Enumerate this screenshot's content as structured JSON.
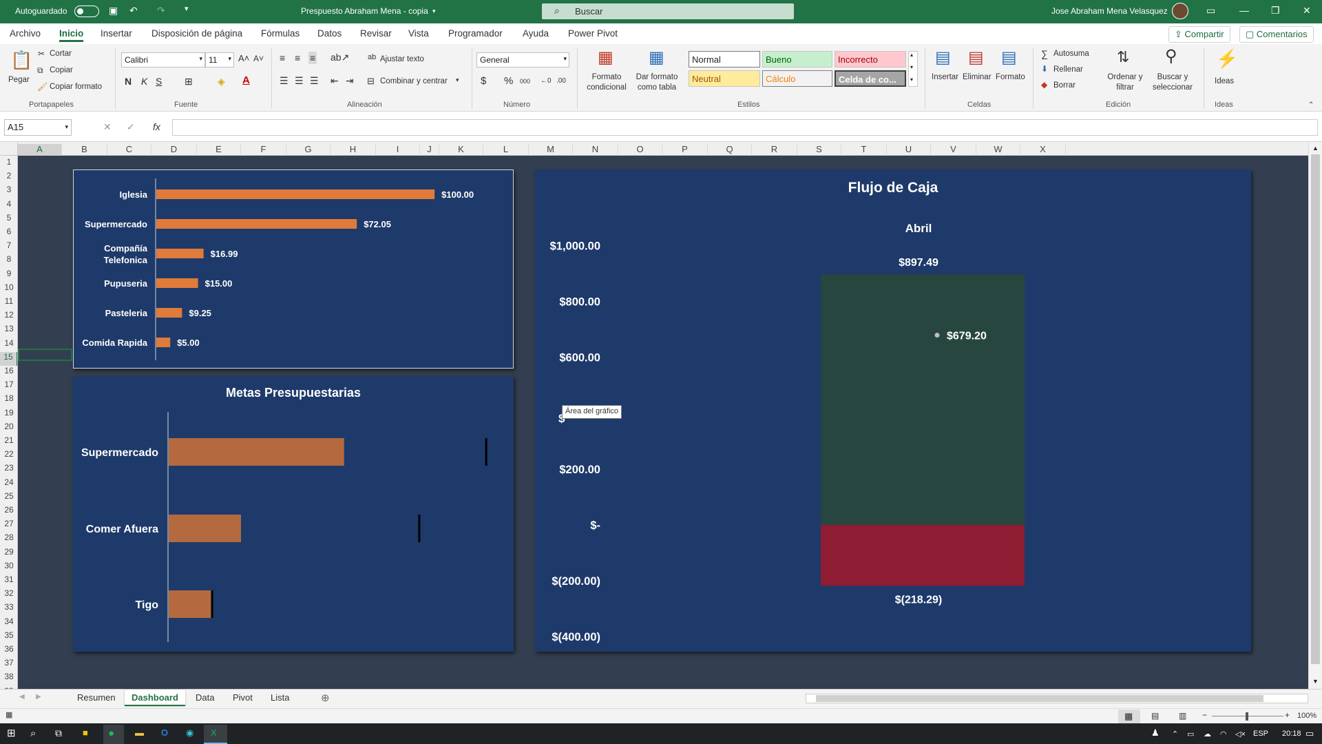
{
  "titlebar": {
    "autosave_label": "Autoguardado",
    "file_title": "Prespuesto Abraham Mena - copia",
    "search_placeholder": "Buscar",
    "user": "Jose Abraham Mena Velasquez"
  },
  "menu": {
    "items": [
      "Archivo",
      "Inicio",
      "Insertar",
      "Disposición de página",
      "Fórmulas",
      "Datos",
      "Revisar",
      "Vista",
      "Programador",
      "Ayuda",
      "Power Pivot"
    ],
    "share": "Compartir",
    "comments": "Comentarios"
  },
  "ribbon": {
    "clipboard": {
      "paste": "Pegar",
      "cut": "Cortar",
      "copy": "Copiar",
      "format_painter": "Copiar formato",
      "label": "Portapapeles"
    },
    "font": {
      "name": "Calibri",
      "size": "11",
      "bold": "N",
      "italic": "K",
      "underline": "S",
      "label": "Fuente"
    },
    "alignment": {
      "wrap": "Ajustar texto",
      "merge": "Combinar y centrar",
      "label": "Alineación"
    },
    "number": {
      "format": "General",
      "label": "Número"
    },
    "styles": {
      "conditional": [
        "Formato",
        "condicional"
      ],
      "as_table": [
        "Dar formato",
        "como tabla"
      ],
      "normal": "Normal",
      "bueno": "Bueno",
      "incorrecto": "Incorrecto",
      "neutral": "Neutral",
      "calculo": "Cálculo",
      "celda": "Celda de co...",
      "label": "Estilos"
    },
    "cells": {
      "insert": "Insertar",
      "delete": "Eliminar",
      "format": "Formato",
      "label": "Celdas"
    },
    "editing": {
      "autosum": "Autosuma",
      "fill": "Rellenar",
      "clear": "Borrar",
      "sort": [
        "Ordenar y",
        "filtrar"
      ],
      "find": [
        "Buscar y",
        "seleccionar"
      ],
      "label": "Edición"
    },
    "ideas": {
      "button": "Ideas",
      "label": "Ideas"
    }
  },
  "formula_bar": {
    "name_box": "A15",
    "value": ""
  },
  "columns": [
    "A",
    "B",
    "C",
    "D",
    "E",
    "F",
    "G",
    "H",
    "I",
    "J",
    "K",
    "L",
    "M",
    "N",
    "O",
    "P",
    "Q",
    "R",
    "S",
    "T",
    "U",
    "V",
    "W",
    "X"
  ],
  "rows": [
    "1",
    "2",
    "3",
    "4",
    "5",
    "6",
    "7",
    "8",
    "9",
    "10",
    "11",
    "12",
    "13",
    "14",
    "15",
    "16",
    "17",
    "18",
    "19",
    "20",
    "21",
    "22",
    "23",
    "24",
    "25",
    "26",
    "27",
    "28",
    "29",
    "30",
    "31",
    "32",
    "33",
    "34",
    "35",
    "36",
    "37",
    "38",
    "39"
  ],
  "selected_row": "15",
  "colors": {
    "excel_green": "#217346",
    "chart_bg": "#1e3a6a",
    "bar_orange": "#e07b39",
    "bar_brown": "#b4693f",
    "positive_block": "#27463f",
    "negative_block": "#8e1c33",
    "sheet_bg": "#333f50"
  },
  "chart_data": [
    {
      "type": "bar",
      "orientation": "horizontal",
      "categories": [
        "Iglesia",
        "Supermercado",
        "Compañía Telefonica",
        "Pupuseria",
        "Pasteleria",
        "Comida Rapida"
      ],
      "values": [
        100.0,
        72.05,
        16.99,
        15.0,
        9.25,
        5.0
      ],
      "data_labels": [
        "$100.00",
        "$72.05",
        "$16.99",
        "$15.00",
        "$9.25",
        "$5.00"
      ],
      "xlim": [
        0,
        100
      ]
    },
    {
      "type": "bar",
      "orientation": "horizontal",
      "subtype": "bullet",
      "title": "Metas Presupuestarias",
      "categories": [
        "Supermercado",
        "Comer Afuera",
        "Tigo"
      ],
      "values": [
        72.05,
        29.7,
        17.4
      ],
      "targets": [
        130,
        102.5,
        17.4
      ],
      "xlim": [
        0,
        140
      ]
    },
    {
      "type": "bar",
      "subtype": "waterfall",
      "title": "Flujo de Caja",
      "categories": [
        "Abril"
      ],
      "yticks": [
        "$1,000.00",
        "$800.00",
        "$600.00",
        "$200.00",
        "$-",
        "$(200.00)",
        "$(400.00)"
      ],
      "ylim": [
        -400,
        1000
      ],
      "series": [
        {
          "name": "positive",
          "values": [
            897.49
          ],
          "label": "$897.49"
        },
        {
          "name": "negative",
          "values": [
            -218.29
          ],
          "label": "$(218.29)"
        },
        {
          "name": "balance",
          "values": [
            679.2
          ],
          "label": "$679.20"
        }
      ],
      "tooltip": "Área del gráfico",
      "hidden_tick_fragment": "$"
    }
  ],
  "sheets": {
    "tabs": [
      "Resumen",
      "Dashboard",
      "Data",
      "Pivot",
      "Lista"
    ],
    "active": "Dashboard"
  },
  "status": {
    "zoom": "100%"
  },
  "taskbar": {
    "lang": "ESP",
    "time": "20:18"
  }
}
